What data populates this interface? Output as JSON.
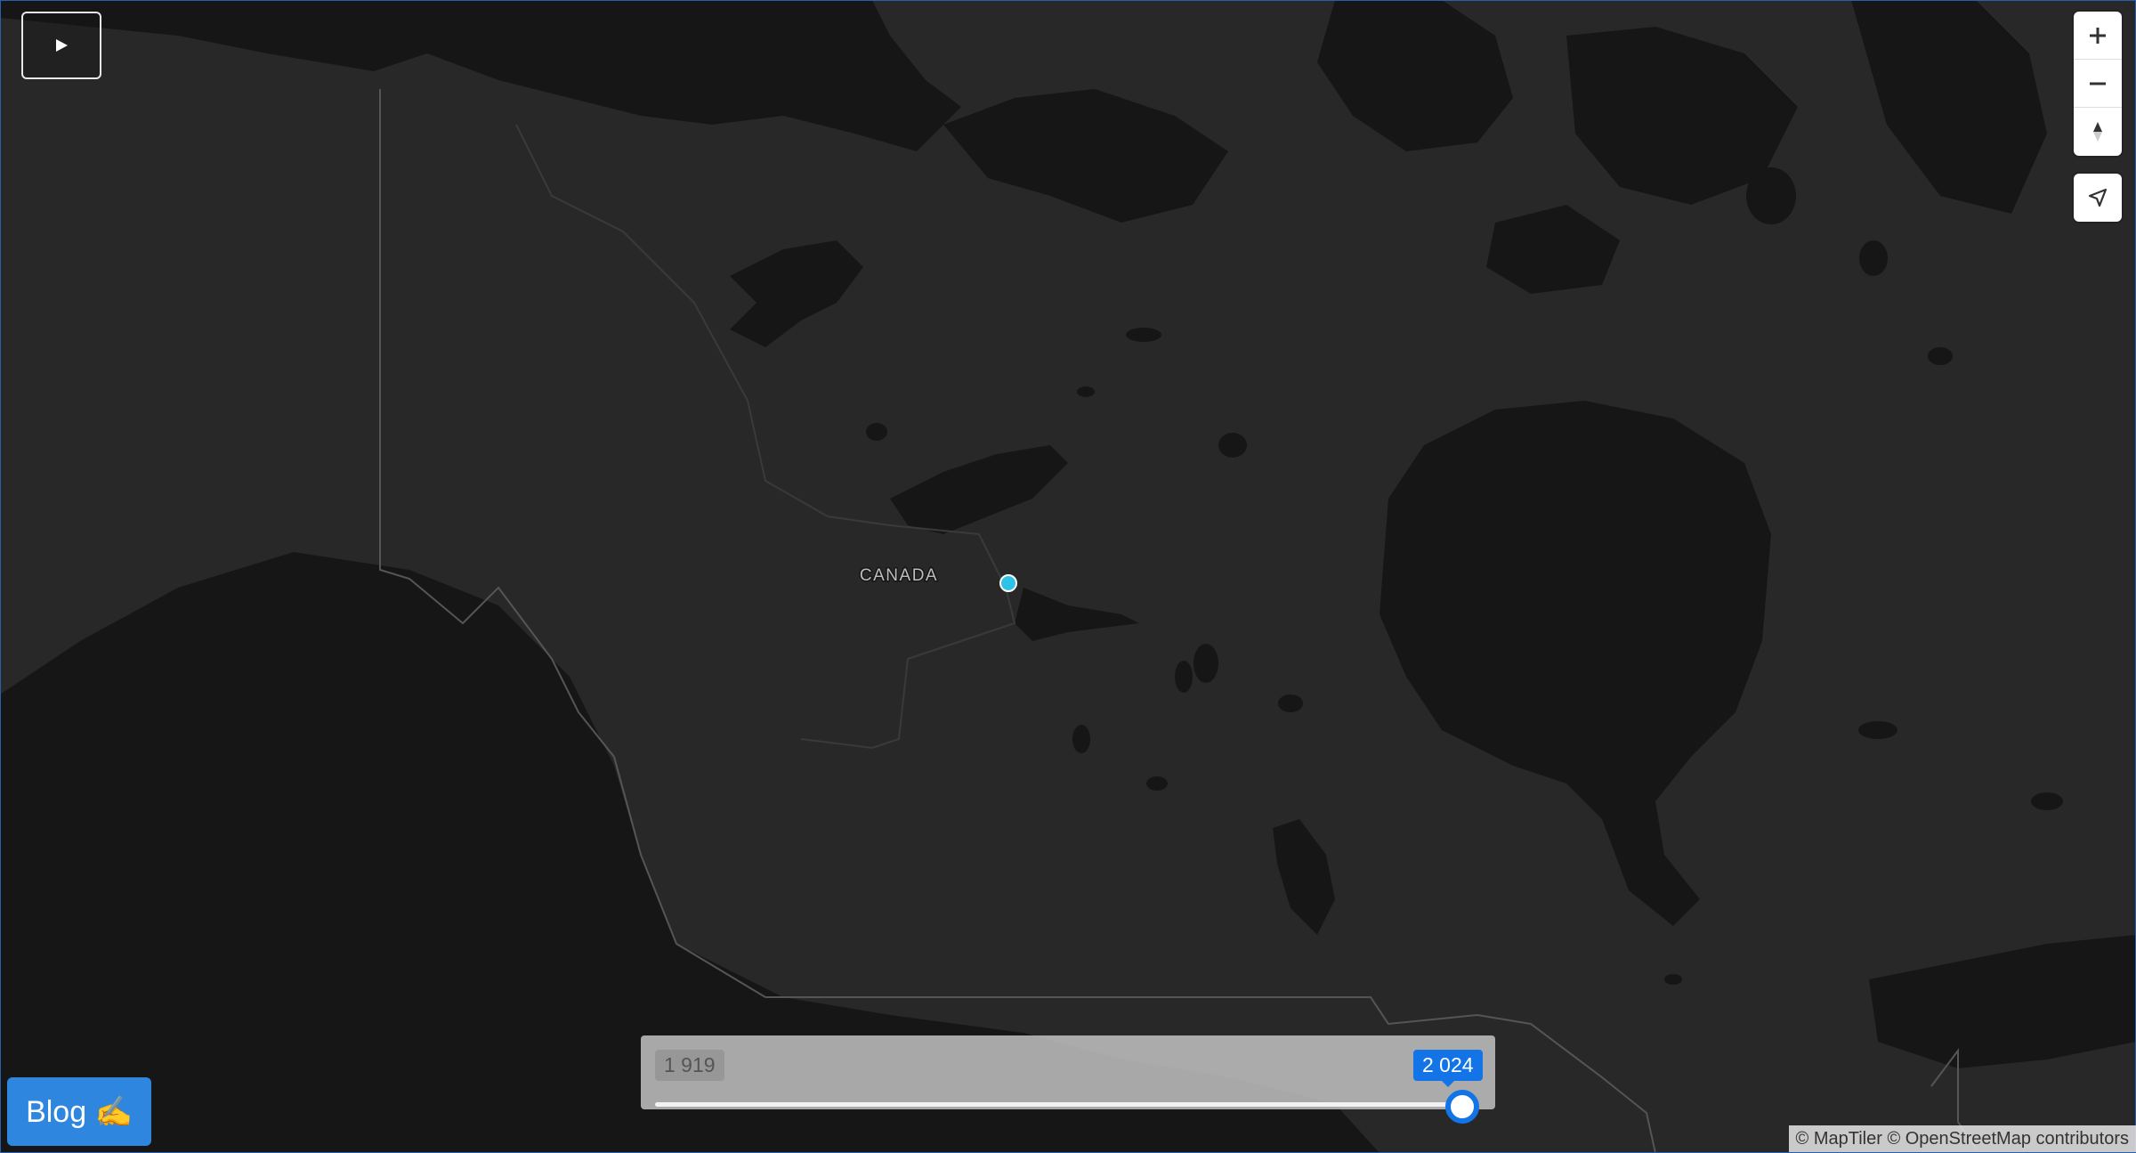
{
  "map": {
    "country_label": "CANADA",
    "marker_color": "#2ec3e6",
    "land_color": "#282828",
    "water_color": "#161616"
  },
  "playback": {
    "icon": "play-icon"
  },
  "controls": {
    "zoom_in_icon": "plus-icon",
    "zoom_out_icon": "minus-icon",
    "compass_icon": "compass-icon",
    "geolocate_icon": "navigation-arrow-icon"
  },
  "year_slider": {
    "min_label": "1 919",
    "max_label": "2 024",
    "min_year": 1919,
    "max_year": 2024,
    "selected_year": 2024,
    "accent_color": "#1274e6"
  },
  "blog": {
    "label": "Blog ✍️"
  },
  "attribution": {
    "maptiler": "© MapTiler",
    "osm": "© OpenStreetMap contributors"
  }
}
